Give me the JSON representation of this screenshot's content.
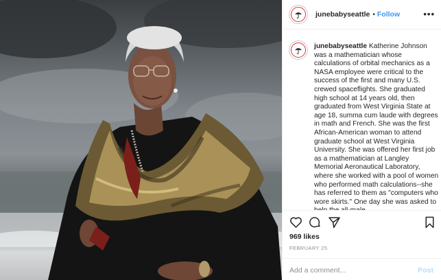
{
  "post": {
    "username": "junebabyseattle",
    "follow_separator": "•",
    "follow_label": "Follow",
    "more_label": "•••",
    "caption_user": "junebabyseattle",
    "caption_text": "Katherine Johnson was a mathematician whose calculations of orbital mechanics as a NASA employee were critical to the success of the first and many U.S. crewed spaceflights. She graduated high school at 14 years old, then graduated from West Virginia State at age 18, summa cum laude with degrees in math and French. She was the first African-American woman to attend graduate school at West Virginia University. She was offered her first job as a mathematician at Langley Memorial Aeronautical Laboratory, where she worked with a pool of women who performed math calculations--she has referred to them as \"computers who wore skirts.\" One day she was asked to help the all-male",
    "likes": "969 likes",
    "date": "FEBRUARY 25",
    "comment_placeholder": "Add a comment...",
    "post_label": "Post"
  },
  "icons": {
    "avatar": "umbrella-logo-icon",
    "like": "heart-icon",
    "comment": "comment-bubble-icon",
    "share": "paper-plane-icon",
    "save": "bookmark-icon"
  },
  "colors": {
    "follow": "#3897f0",
    "post_button": "#b2dffc",
    "muted": "#8e8e8e",
    "text": "#262626"
  }
}
